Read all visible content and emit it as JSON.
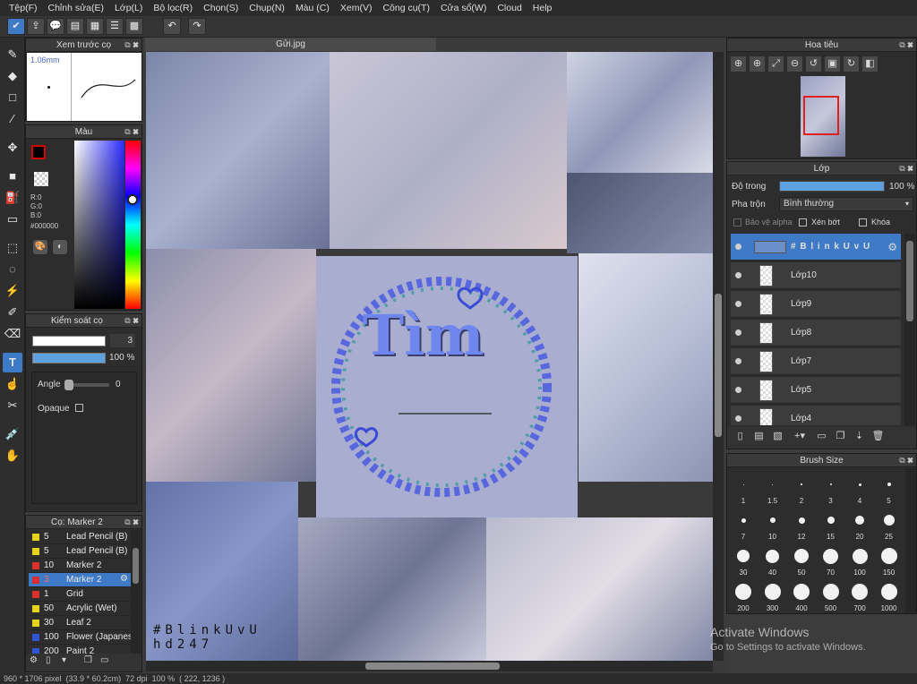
{
  "menu": [
    "Tệp(F)",
    "Chỉnh sửa(E)",
    "Lớp(L)",
    "Bộ lọc(R)",
    "Chọn(S)",
    "Chụp(N)",
    "Màu (C)",
    "Xem(V)",
    "Công cụ(T)",
    "Cửa sổ(W)",
    "Cloud",
    "Help"
  ],
  "document": {
    "tab_title": "Gửi.jpg"
  },
  "brush_preview": {
    "title": "Xem trước cọ",
    "size": "1.06mm"
  },
  "color_panel": {
    "title": "Màu",
    "r": "R:0",
    "g": "G:0",
    "b": "B:0",
    "hex": "#000000"
  },
  "brush_control": {
    "title": "Kiểm soát cọ",
    "size_value": "3",
    "opacity_value": "100 %",
    "angle_label": "Angle",
    "angle_value": "0",
    "opaque_label": "Opaque"
  },
  "brush_list": {
    "title": "Cọ: Marker 2",
    "items": [
      {
        "size": "5",
        "name": "Lead Pencil (B)",
        "color": "#e8d21c"
      },
      {
        "size": "5",
        "name": "Lead Pencil (B)",
        "color": "#e8d21c"
      },
      {
        "size": "10",
        "name": "Marker 2",
        "color": "#d9302e"
      },
      {
        "size": "3",
        "name": "Marker 2",
        "color": "#d9302e",
        "selected": true
      },
      {
        "size": "1",
        "name": "Grid",
        "color": "#d9302e"
      },
      {
        "size": "50",
        "name": "Acrylic (Wet)",
        "color": "#e8d21c"
      },
      {
        "size": "30",
        "name": "Leaf 2",
        "color": "#e8d21c"
      },
      {
        "size": "100",
        "name": "Flower (Japanese)",
        "color": "#2f54d6"
      },
      {
        "size": "200",
        "name": "Paint 2",
        "color": "#2f54d6"
      }
    ]
  },
  "navigator": {
    "title": "Hoa tiêu"
  },
  "layers": {
    "title": "Lớp",
    "opacity_label": "Độ trong",
    "opacity_value": "100 %",
    "blend_label": "Pha trộn",
    "blend_value": "Bình thường",
    "protect_alpha": "Bảo vệ alpha",
    "clipping": "Xén bớt",
    "lock": "Khóa",
    "items": [
      {
        "name": "# B l i n k U v U",
        "selected": true
      },
      {
        "name": "Lớp10"
      },
      {
        "name": "Lớp9"
      },
      {
        "name": "Lớp8"
      },
      {
        "name": "Lớp7"
      },
      {
        "name": "Lớp5"
      },
      {
        "name": "Lớp4"
      }
    ]
  },
  "brush_size": {
    "title": "Brush Size",
    "sizes": [
      "1",
      "1.5",
      "2",
      "3",
      "4",
      "5",
      "7",
      "10",
      "12",
      "15",
      "20",
      "25",
      "30",
      "40",
      "50",
      "70",
      "100",
      "150",
      "200",
      "300",
      "400",
      "500",
      "700",
      "1000"
    ]
  },
  "canvas_text": {
    "title": "Tìm",
    "signature": "#BlinkUvU",
    "credit": "hd247",
    "watermark_line1": "Activate Windows",
    "watermark_line2": "Go to Settings to activate Windows."
  },
  "status_bar": "960 * 1706 pixel  (33.9 * 60.2cm)  72 dpi  100 %  ( 222, 1236 )",
  "colors": {
    "accent": "#3e7ac6",
    "foreground": "#d40000",
    "background": "#00cc00"
  }
}
